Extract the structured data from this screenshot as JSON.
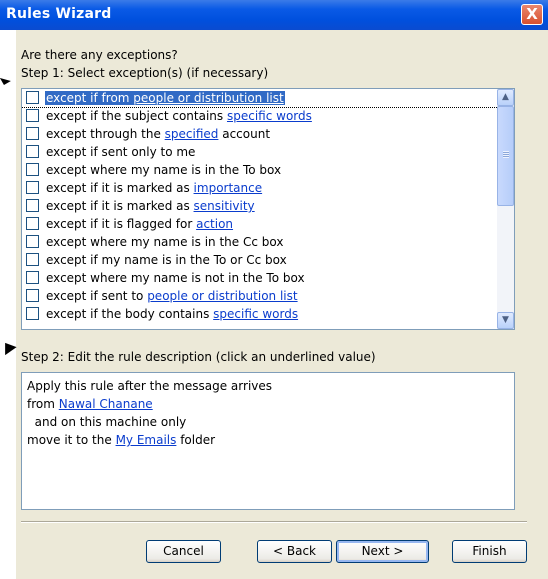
{
  "window": {
    "title": "Rules Wizard",
    "close_glyph": "X"
  },
  "question": "Are there any exceptions?",
  "step1_label": "Step 1: Select exception(s) (if necessary)",
  "exceptions": [
    {
      "before": "except if from ",
      "link": "people or distribution list",
      "after": ""
    },
    {
      "before": "except if the subject contains ",
      "link": "specific words",
      "after": ""
    },
    {
      "before": "except through the ",
      "link": "specified",
      "after": " account"
    },
    {
      "before": "except if sent only to me",
      "link": "",
      "after": ""
    },
    {
      "before": "except where my name is in the To box",
      "link": "",
      "after": ""
    },
    {
      "before": "except if it is marked as ",
      "link": "importance",
      "after": ""
    },
    {
      "before": "except if it is marked as ",
      "link": "sensitivity",
      "after": ""
    },
    {
      "before": "except if it is flagged for ",
      "link": "action",
      "after": ""
    },
    {
      "before": "except where my name is in the Cc box",
      "link": "",
      "after": ""
    },
    {
      "before": "except if my name is in the To or Cc box",
      "link": "",
      "after": ""
    },
    {
      "before": "except where my name is not in the To box",
      "link": "",
      "after": ""
    },
    {
      "before": "except if sent to ",
      "link": "people or distribution list",
      "after": ""
    },
    {
      "before": "except if the body contains ",
      "link": "specific words",
      "after": ""
    }
  ],
  "step2_label": "Step 2: Edit the rule description (click an underlined value)",
  "description": {
    "line1": "Apply this rule after the message arrives",
    "line2_prefix": "from ",
    "line2_link": "Nawal Chanane",
    "line3": "  and on this machine only",
    "line4_prefix": "move it to the ",
    "line4_link": "My Emails",
    "line4_suffix": " folder"
  },
  "buttons": {
    "cancel": "Cancel",
    "back": "< Back",
    "next": "Next >",
    "finish": "Finish"
  },
  "scroll_arrows": {
    "up": "▲",
    "down": "▼"
  },
  "colors": {
    "titlebar": "#0050de",
    "selection": "#316ac5",
    "link": "#0a3ccd",
    "dialog_bg": "#ece9d8"
  }
}
